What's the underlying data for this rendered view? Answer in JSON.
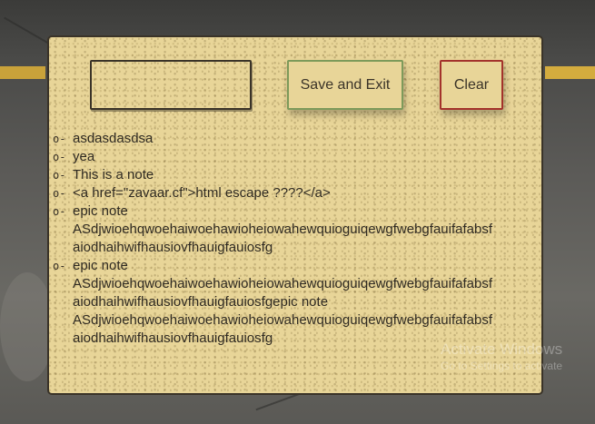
{
  "notepad": {
    "input_value": "",
    "save_button_label": "Save and Exit",
    "clear_button_label": "Clear",
    "bullet_glyph": "o-"
  },
  "notes": [
    {
      "text": "asdasdasdsa"
    },
    {
      "text": "yea"
    },
    {
      "text": "This is a note"
    },
    {
      "text": "<a href=\"zavaar.cf\">html escape ????</a>"
    },
    {
      "text": "epic note\nASdjwioehqwoehaiwoehawioheiowahewquioguiqewgfwebgfauifafabsf\naiodhaihwifhausiovfhauigfauiosfg"
    },
    {
      "text": "epic note\nASdjwioehqwoehaiwoehawioheiowahewquioguiqewgfwebgfauifafabsf\naiodhaihwifhausiovfhauigfauiosfgepic note\nASdjwioehqwoehaiwoehawioheiowahewquioguiqewgfwebgfauifafabsf\naiodhaihwifhausiovfhauigfauiosfg"
    }
  ],
  "watermark": {
    "title": "Activate Windows",
    "subtitle": "Go to Settings to activate"
  },
  "colors": {
    "panel_bg": "#e8d598",
    "save_border": "#7d9a5a",
    "clear_border": "#a3322b"
  }
}
